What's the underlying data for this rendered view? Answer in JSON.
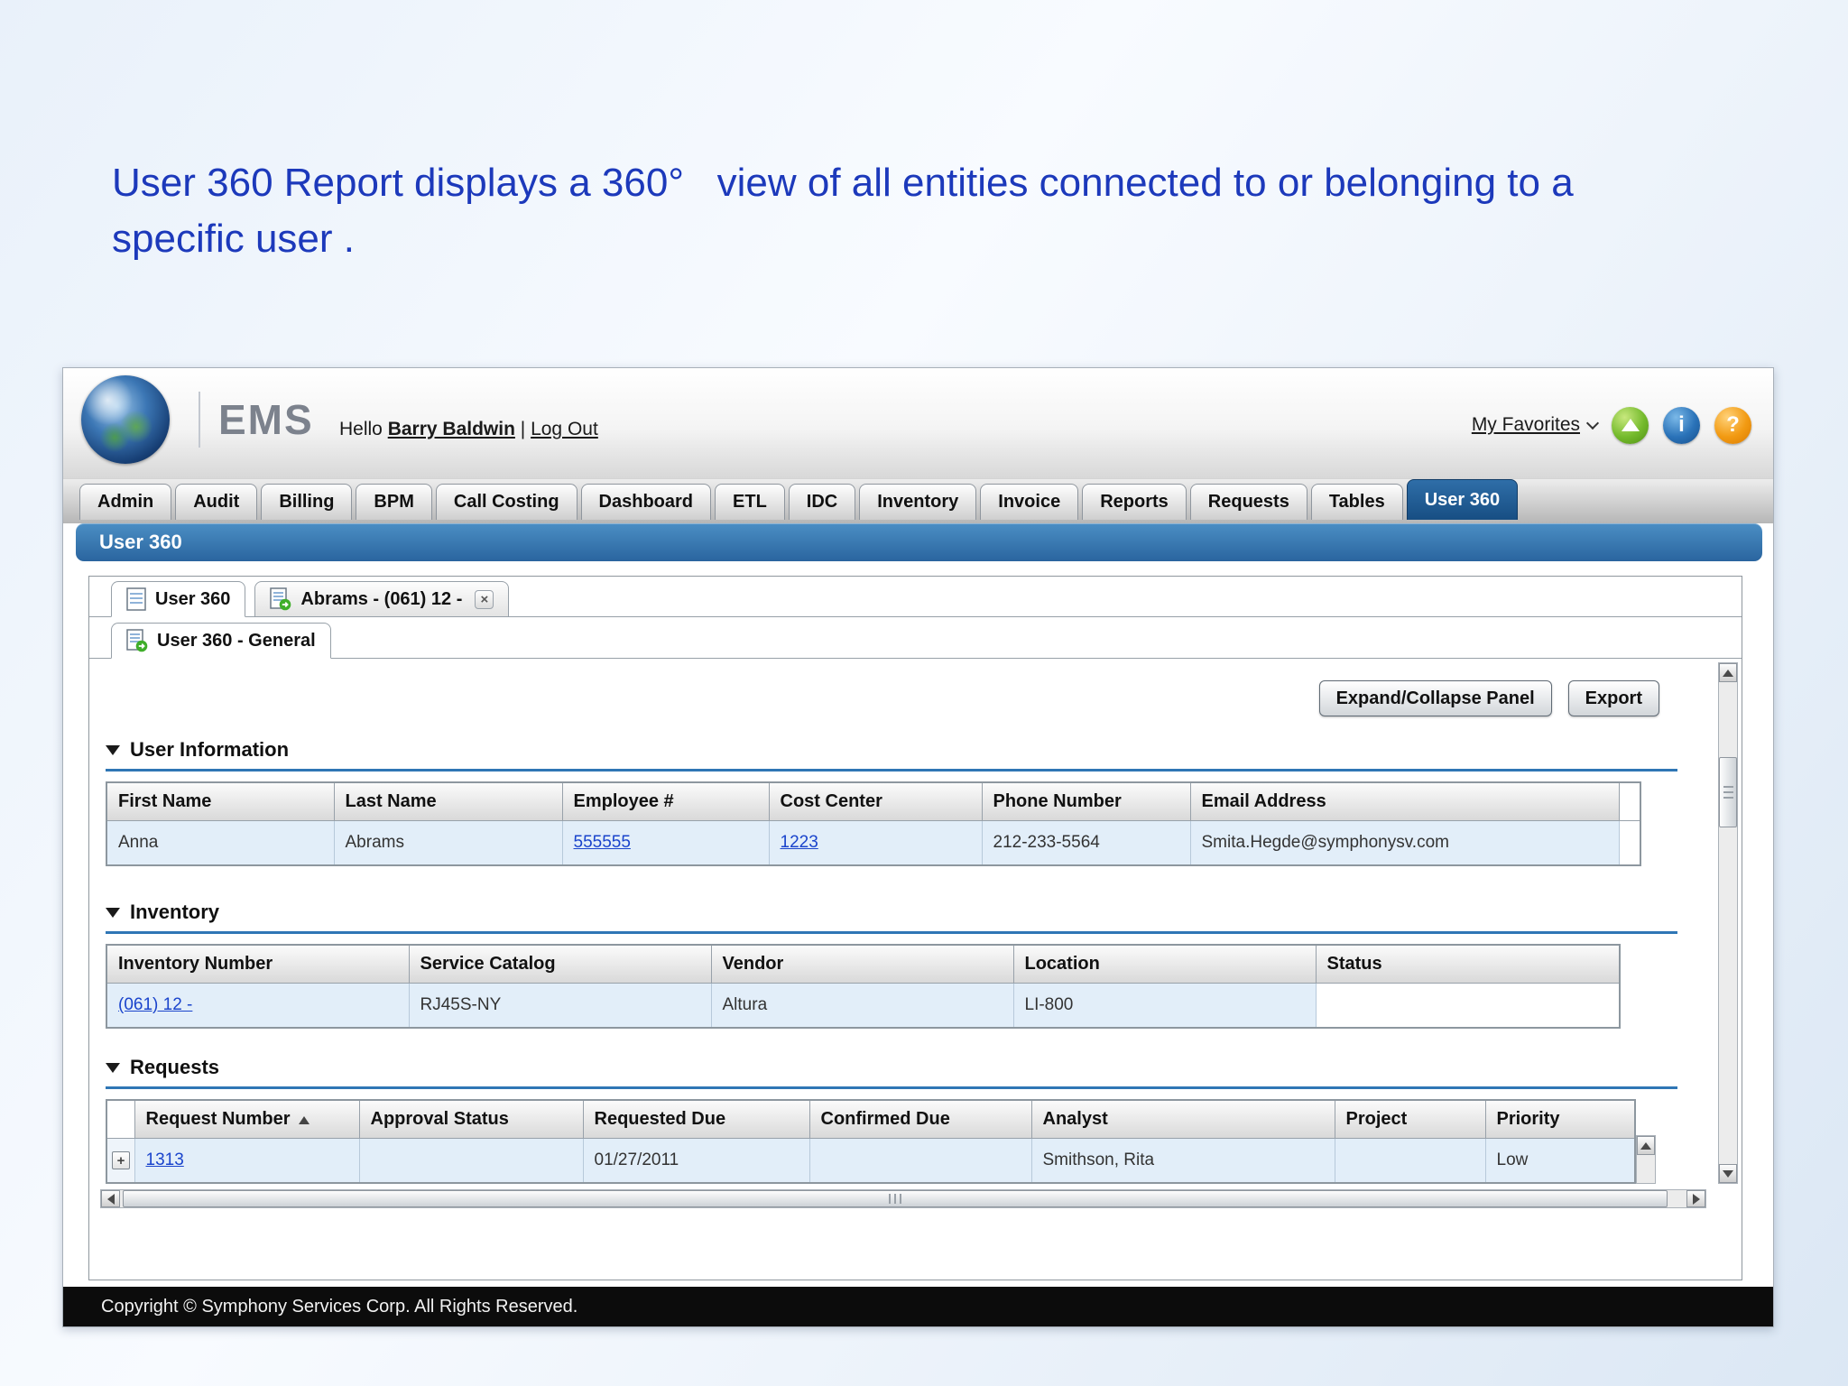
{
  "caption": {
    "text": "User 360 Report displays a 360°   view of all entities connected to or belonging to a\nspecific user ."
  },
  "header": {
    "logo_text": "EMS",
    "greeting_prefix": "Hello",
    "user_name": "Barry Baldwin",
    "separator": "|",
    "logout_label": "Log Out",
    "favorites_label": "My Favorites",
    "info_glyph": "i",
    "help_glyph": "?"
  },
  "nav": {
    "breadcrumb": "User 360",
    "active_tab": "User 360",
    "tabs": [
      {
        "label": "Admin"
      },
      {
        "label": "Audit"
      },
      {
        "label": "Billing"
      },
      {
        "label": "BPM"
      },
      {
        "label": "Call Costing"
      },
      {
        "label": "Dashboard"
      },
      {
        "label": "ETL"
      },
      {
        "label": "IDC"
      },
      {
        "label": "Inventory"
      },
      {
        "label": "Invoice"
      },
      {
        "label": "Reports"
      },
      {
        "label": "Requests"
      },
      {
        "label": "Tables"
      },
      {
        "label": "User 360"
      }
    ]
  },
  "workspace": {
    "tabs": [
      {
        "label": "User 360"
      },
      {
        "label": "Abrams - (061) 12 -"
      }
    ],
    "close_glyph": "×",
    "subtab": "User 360 - General",
    "buttons": {
      "expand_collapse": "Expand/Collapse Panel",
      "export": "Export"
    }
  },
  "sections": {
    "user_information": {
      "title": "User Information",
      "columns": [
        "First Name",
        "Last Name",
        "Employee #",
        "Cost Center",
        "Phone Number",
        "Email Address"
      ],
      "row": {
        "first_name": "Anna",
        "last_name": "Abrams",
        "employee_no": "555555",
        "cost_center": "1223",
        "phone": "212-233-5564",
        "email": "Smita.Hegde@symphonysv.com"
      }
    },
    "inventory": {
      "title": "Inventory",
      "columns": [
        "Inventory Number",
        "Service Catalog",
        "Vendor",
        "Location",
        "Status"
      ],
      "row": {
        "inventory_number": "(061) 12 -",
        "service_catalog": "RJ45S-NY",
        "vendor": "Altura",
        "location": "LI-800",
        "status": ""
      }
    },
    "requests": {
      "title": "Requests",
      "expand_glyph": "+",
      "sort_column": "Request Number",
      "sort_direction": "asc",
      "columns": [
        "Request Number",
        "Approval Status",
        "Requested Due",
        "Confirmed Due",
        "Analyst",
        "Project",
        "Priority"
      ],
      "row": {
        "request_number": "1313",
        "approval_status": "",
        "requested_due": "01/27/2011",
        "confirmed_due": "",
        "analyst": "Smithson, Rita",
        "project": "",
        "priority": "Low"
      }
    }
  },
  "footer": {
    "copyright": "Copyright © Symphony Services Corp. All Rights Reserved."
  },
  "colors": {
    "caption_blue": "#1c39bb",
    "active_tab_blue": "#1b5384",
    "title_bar_blue": "#2f6ca6",
    "section_rule_blue": "#2f76b5",
    "link_blue": "#1a44cc",
    "row_highlight": "#e2eef9"
  }
}
